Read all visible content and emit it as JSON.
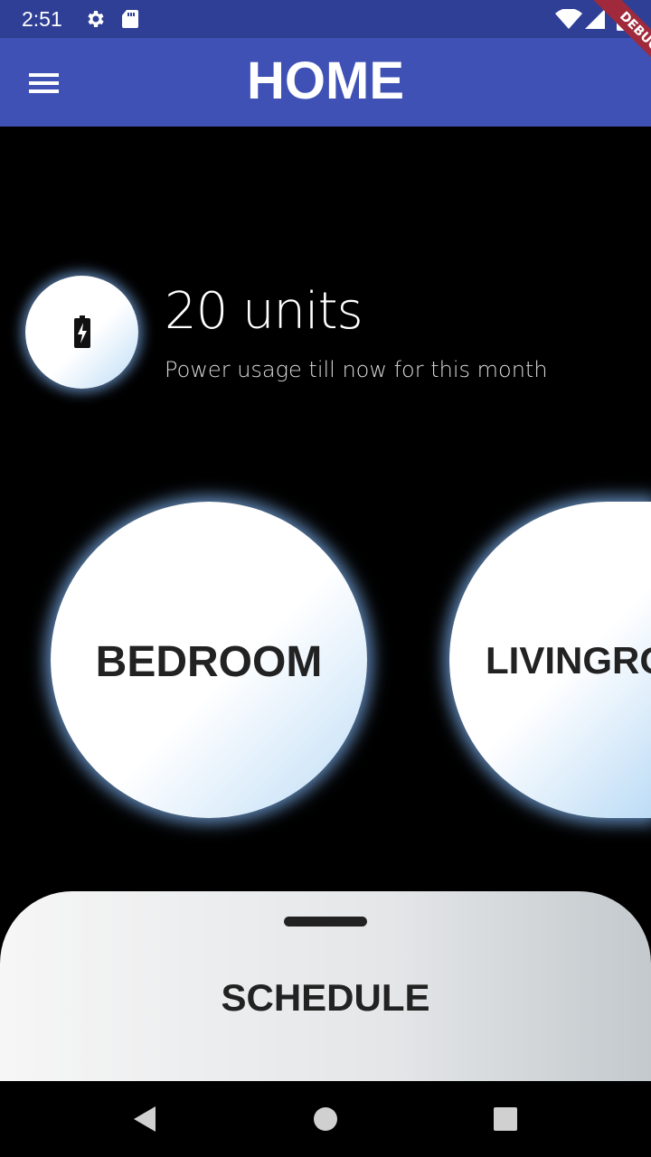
{
  "status_bar": {
    "time": "2:51",
    "icons": [
      "gear-icon",
      "sd-card-icon",
      "wifi-icon",
      "signal-icon",
      "battery-icon"
    ]
  },
  "app_bar": {
    "title": "HOME",
    "menu_icon": "menu-icon",
    "debug_label": "DEBUG",
    "color": "#3f51b5"
  },
  "usage": {
    "value": "20 units",
    "caption": "Power usage till now for this month",
    "icon": "battery-charging-icon"
  },
  "rooms": [
    {
      "label": "BEDROOM"
    },
    {
      "label": "LIVINGROOM"
    }
  ],
  "sheet": {
    "label": "SCHEDULE"
  },
  "nav": {
    "icons": [
      "back-icon",
      "home-icon",
      "recents-icon"
    ]
  }
}
